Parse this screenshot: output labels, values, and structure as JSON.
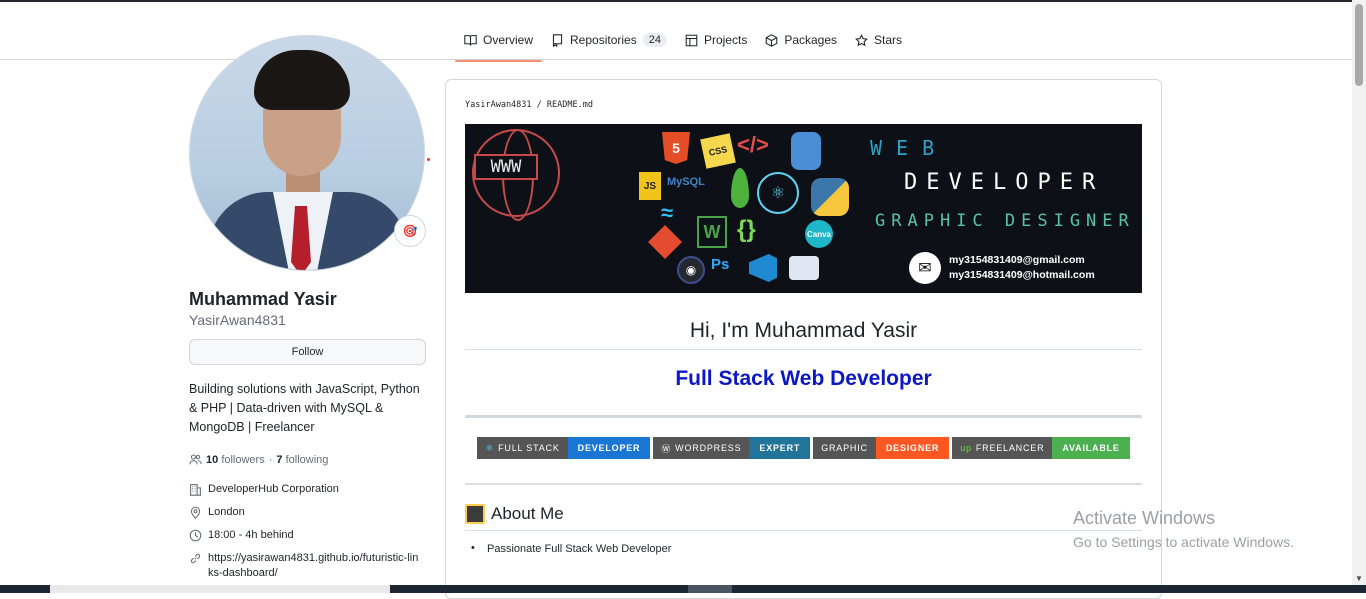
{
  "tabs": [
    {
      "label": "Overview",
      "icon": "book-icon",
      "active": true
    },
    {
      "label": "Repositories",
      "icon": "repo-icon",
      "count": "24"
    },
    {
      "label": "Projects",
      "icon": "table-icon"
    },
    {
      "label": "Packages",
      "icon": "package-icon"
    },
    {
      "label": "Stars",
      "icon": "star-icon"
    }
  ],
  "profile": {
    "name": "Muhammad Yasir",
    "login": "YasirAwan4831",
    "follow_label": "Follow",
    "bio": "Building solutions with JavaScript, Python & PHP | Data-driven with MySQL & MongoDB | Freelancer",
    "followers_count": "10",
    "followers_label": "followers",
    "separator": "·",
    "following_count": "7",
    "following_label": "following",
    "company": "DeveloperHub Corporation",
    "location": "London",
    "time": "18:00 - 4h behind",
    "website": "https://yasirawan4831.github.io/futuristic-links-dashboard/",
    "status_emoji": "🎯"
  },
  "readme": {
    "breadcrumb_user": "YasirAwan4831",
    "breadcrumb_sep": "/",
    "breadcrumb_file": "README.md",
    "banner": {
      "www": "WWW",
      "web": "WEB",
      "developer": "DEVELOPER",
      "graphic": "GRAPHIC DESIGNER",
      "email1": "my3154831409@gmail.com",
      "email2": "my3154831409@hotmail.com",
      "mysql": "MySQL",
      "canva": "Canva",
      "ps": "Ps"
    },
    "greeting": "Hi, I'm Muhammad Yasir",
    "role": "Full Stack Web Developer",
    "badges": [
      {
        "left": "FULL STACK",
        "right": "DEVELOPER",
        "color": "#1976d2"
      },
      {
        "left": "WORDPRESS",
        "right": "EXPERT",
        "color": "#21759b"
      },
      {
        "left": "GRAPHIC",
        "right": "DESIGNER",
        "color": "#ff5722"
      },
      {
        "left": "FREELANCER",
        "right": "AVAILABLE",
        "color": "#4caf50"
      }
    ],
    "about_title": "About Me",
    "bullet_prefix": "Passionate ",
    "bullet_bold": "Full Stack Web Developer"
  },
  "watermark": {
    "line1": "Activate Windows",
    "line2": "Go to Settings to activate Windows."
  }
}
